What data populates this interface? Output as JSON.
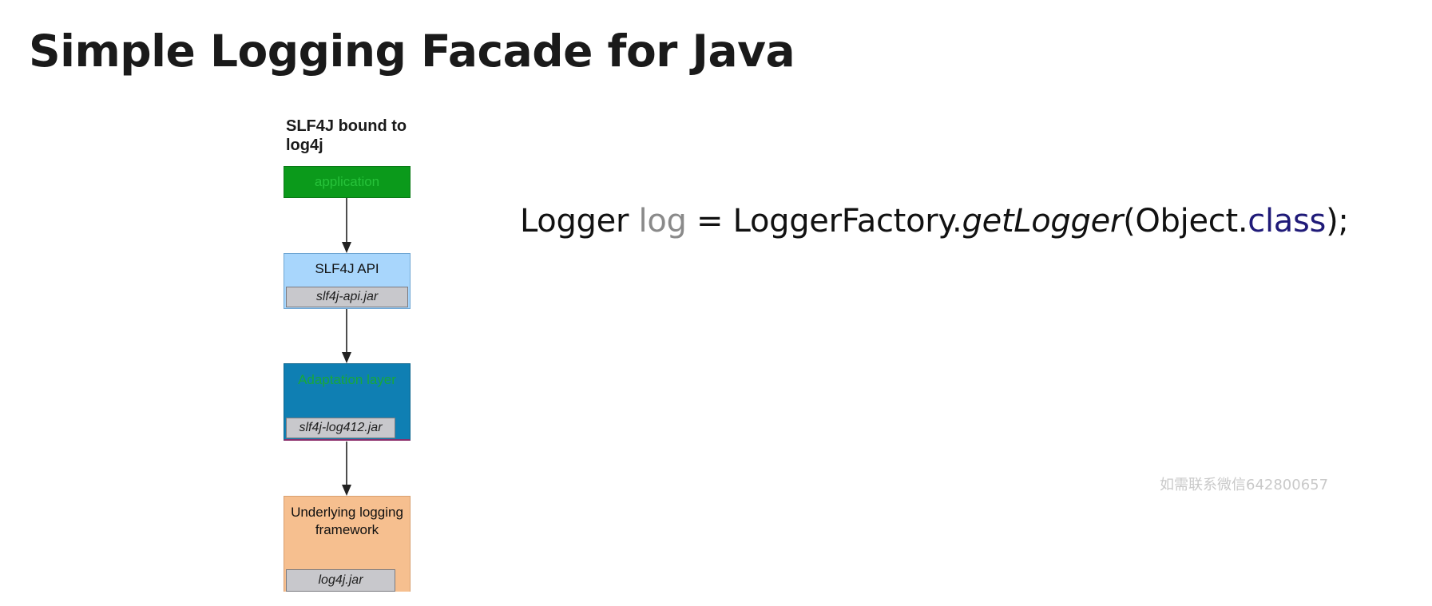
{
  "slide": {
    "title": "Simple Logging Facade for Java",
    "diagram_caption": "SLF4J bound to log4j",
    "watermark": "如需联系微信642800657"
  },
  "diagram": {
    "application": {
      "label": "application"
    },
    "slf4j_api": {
      "label": "SLF4J API",
      "jar": "slf4j-api.jar"
    },
    "adaptation": {
      "label": "Adaptation layer",
      "jar": "slf4j-log412.jar"
    },
    "underlying": {
      "label": "Underlying logging framework",
      "jar": "log4j.jar"
    }
  },
  "code": {
    "type": "Logger",
    "variable": "log",
    "equals": "=",
    "factory": "LoggerFactory.",
    "method": "getLogger",
    "open_paren": "(",
    "object": "Object.",
    "keyword": "class",
    "close": ");"
  },
  "colors": {
    "application_box": "#0b9a1b",
    "api_box": "#a8d6fc",
    "adaptation_box": "#0f7fb3",
    "underlying_box": "#f6bf8f",
    "jar_box": "#c8c8cc",
    "keyword": "#1f1a78",
    "variable": "#8a8a8a"
  }
}
